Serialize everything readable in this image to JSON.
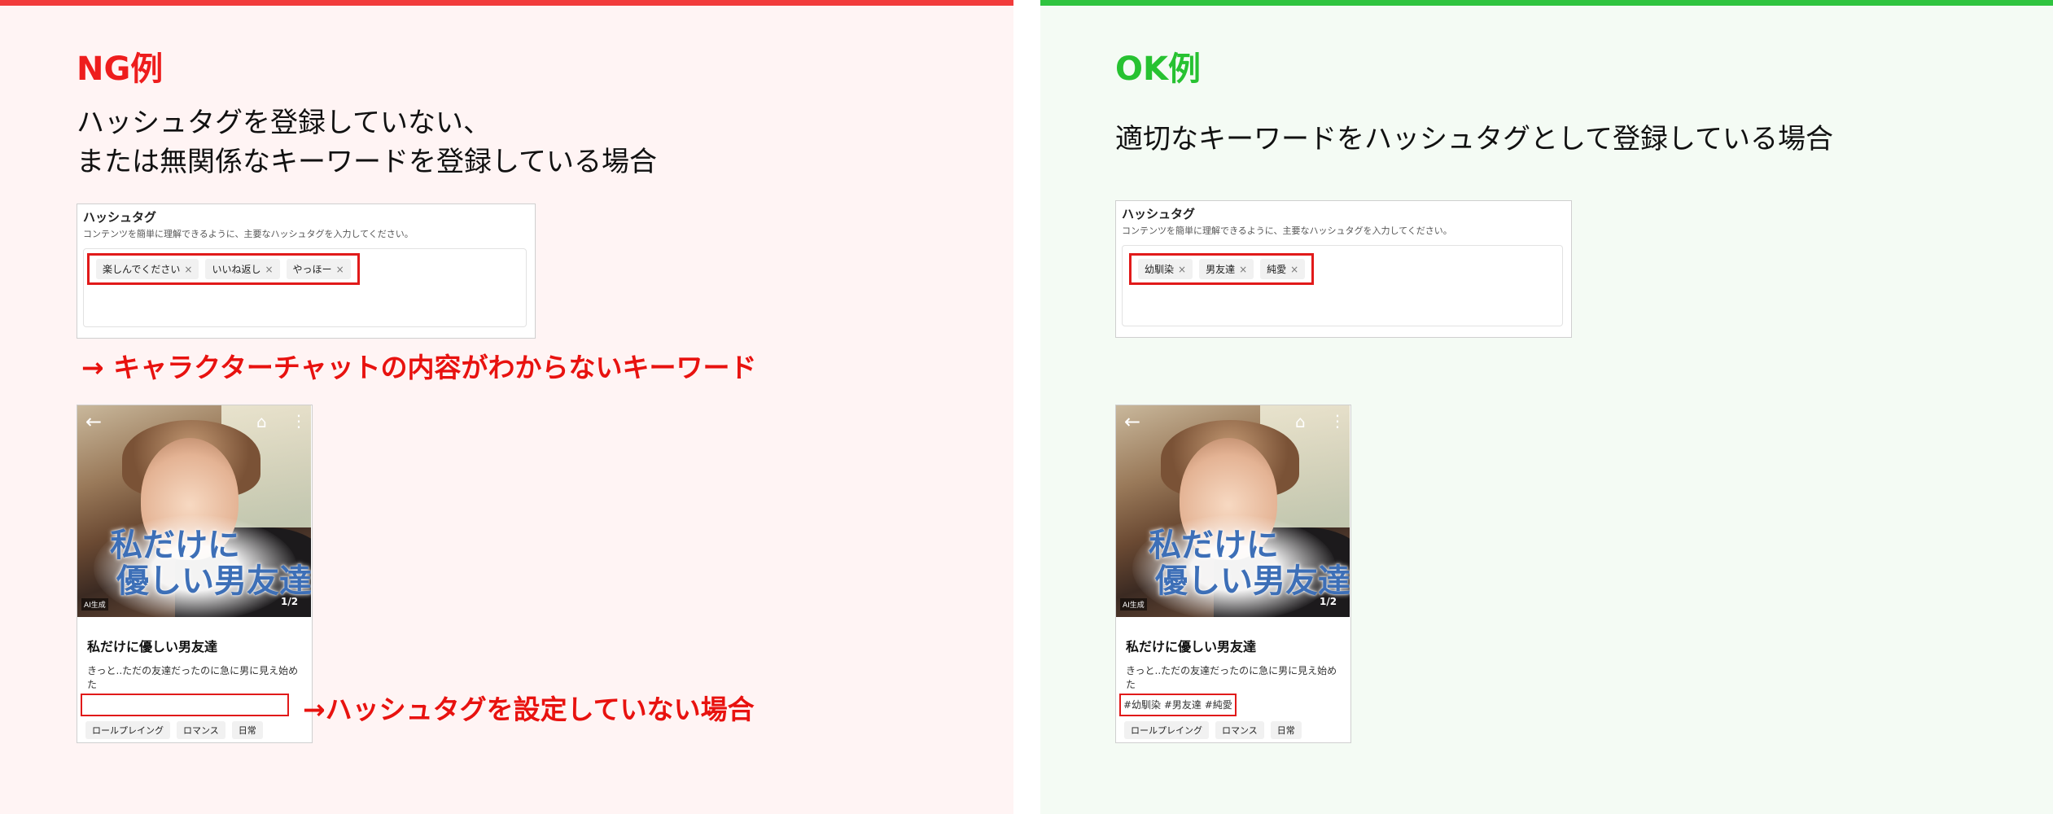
{
  "ng": {
    "title": "NG例",
    "desc_lines": [
      "ハッシュタグを登録していない、",
      "または無関係なキーワードを登録している場合"
    ],
    "form": {
      "label": "ハッシュタグ",
      "help": "コンテンツを簡単に理解できるように、主要なハッシュタグを入力してください。",
      "tags": [
        "楽しんでください",
        "いいね返し",
        "やっほー"
      ]
    },
    "annotation_keyword": "→ キャラクターチャットの内容がわからないキーワード",
    "annotation_hashtag": "→ハッシュタグを設定していない場合",
    "card": {
      "image_title": [
        "私だけに",
        "優しい男友達"
      ],
      "ai_badge": "AI生成",
      "pager": "1/2",
      "name": "私だけに優しい男友達",
      "description": "きっと..ただの友達だったのに急に男に見え始めた",
      "hashtags": "",
      "genres": [
        "ロールプレイング",
        "ロマンス",
        "日常"
      ]
    }
  },
  "ok": {
    "title": "OK例",
    "desc_lines": [
      "適切なキーワードをハッシュタグとして登録している場合"
    ],
    "form": {
      "label": "ハッシュタグ",
      "help": "コンテンツを簡単に理解できるように、主要なハッシュタグを入力してください。",
      "tags": [
        "幼馴染",
        "男友達",
        "純愛"
      ]
    },
    "card": {
      "image_title": [
        "私だけに",
        "優しい男友達"
      ],
      "ai_badge": "AI生成",
      "pager": "1/2",
      "name": "私だけに優しい男友達",
      "description": "きっと..ただの友達だったのに急に男に見え始めた",
      "hashtags": "#幼馴染 #男友達 #純愛",
      "genres": [
        "ロールプレイング",
        "ロマンス",
        "日常"
      ]
    }
  },
  "icons": {
    "tag_remove": "×",
    "back": "←",
    "home": "⌂",
    "more": "⋮"
  },
  "colors": {
    "ng_accent": "#f23b3b",
    "ok_accent": "#2fc43f",
    "highlight_box": "#e11a1a"
  }
}
